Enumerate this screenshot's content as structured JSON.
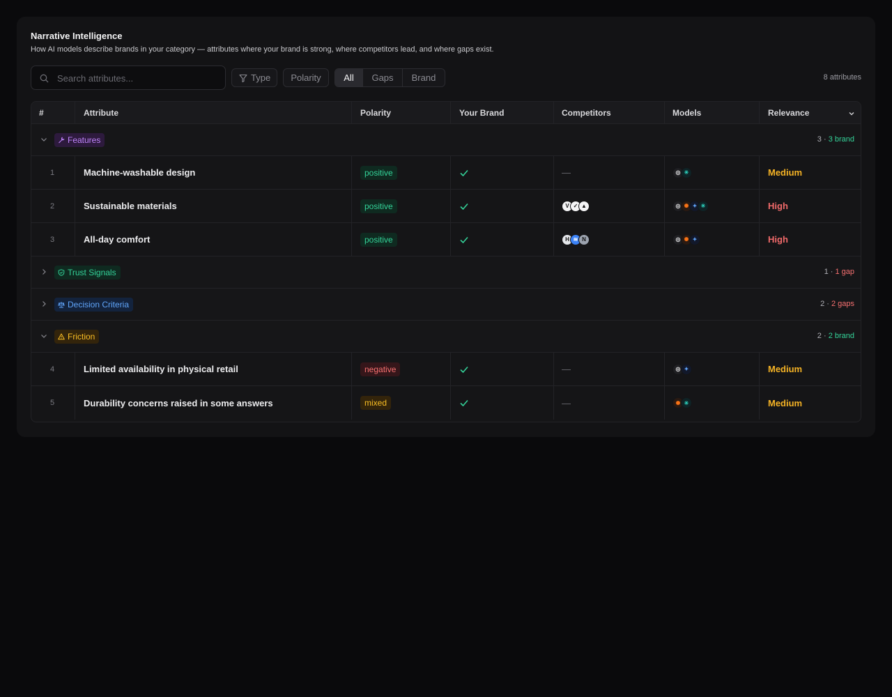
{
  "header": {
    "title": "Narrative Intelligence",
    "subtitle": "How AI models describe brands in your category — attributes where your brand is strong, where competitors lead, and where gaps exist."
  },
  "toolbar": {
    "search_placeholder": "Search attributes...",
    "type_label": "Type",
    "polarity_label": "Polarity",
    "segments": [
      "All",
      "Gaps",
      "Brand"
    ],
    "active_segment": "All",
    "count_label": "8 attributes"
  },
  "columns": {
    "num": "#",
    "attribute": "Attribute",
    "polarity": "Polarity",
    "your_brand": "Your Brand",
    "competitors": "Competitors",
    "models": "Models",
    "relevance": "Relevance"
  },
  "colors": {
    "features": "#c084fc",
    "trust": "#34d399",
    "decision": "#60a5fa",
    "friction": "#fbbf24",
    "brand_count": "#34d399",
    "gap_count": "#f87171"
  },
  "groups": [
    {
      "name": "Features",
      "icon": "wrench-icon",
      "expanded": true,
      "count": "3",
      "status": "3 brand"
    },
    {
      "name": "Trust Signals",
      "icon": "shield-check-icon",
      "expanded": false,
      "count": "1",
      "status": "1 gap"
    },
    {
      "name": "Decision Criteria",
      "icon": "scale-icon",
      "expanded": false,
      "count": "2",
      "status": "2 gaps"
    },
    {
      "name": "Friction",
      "icon": "warning-triangle-icon",
      "expanded": true,
      "count": "2",
      "status": "2 brand"
    }
  ],
  "rows": [
    {
      "num": "1",
      "attribute": "Machine-washable design",
      "polarity": "positive",
      "brand": "check-icon",
      "competitors": "—",
      "relevance": "Medium"
    },
    {
      "num": "2",
      "attribute": "Sustainable materials",
      "polarity": "positive",
      "brand": "check-icon",
      "competitors": "",
      "relevance": "High"
    },
    {
      "num": "3",
      "attribute": "All-day comfort",
      "polarity": "positive",
      "brand": "check-icon",
      "competitors": "",
      "relevance": "High"
    },
    {
      "num": "4",
      "attribute": "Limited availability in physical retail",
      "polarity": "negative",
      "brand": "check-icon",
      "competitors": "—",
      "relevance": "Medium"
    },
    {
      "num": "5",
      "attribute": "Durability concerns raised in some answers",
      "polarity": "mixed",
      "brand": "check-icon",
      "competitors": "—",
      "relevance": "Medium"
    }
  ],
  "competitor_logos": {
    "row2": [
      "veja-logo-icon",
      "nike-logo-icon",
      "adidas-logo-icon"
    ],
    "row3": [
      "hoka-logo-icon",
      "new-balance-logo-icon",
      "nb-logo-icon"
    ]
  },
  "model_logos": {
    "row1": [
      "openai-icon",
      "perplexity-icon"
    ],
    "row2": [
      "openai-icon",
      "claude-icon",
      "gemini-icon",
      "perplexity-icon"
    ],
    "row3": [
      "openai-icon",
      "claude-icon",
      "gemini-icon"
    ],
    "row4": [
      "openai-icon",
      "gemini-icon"
    ],
    "row5": [
      "claude-icon",
      "perplexity-icon"
    ]
  }
}
